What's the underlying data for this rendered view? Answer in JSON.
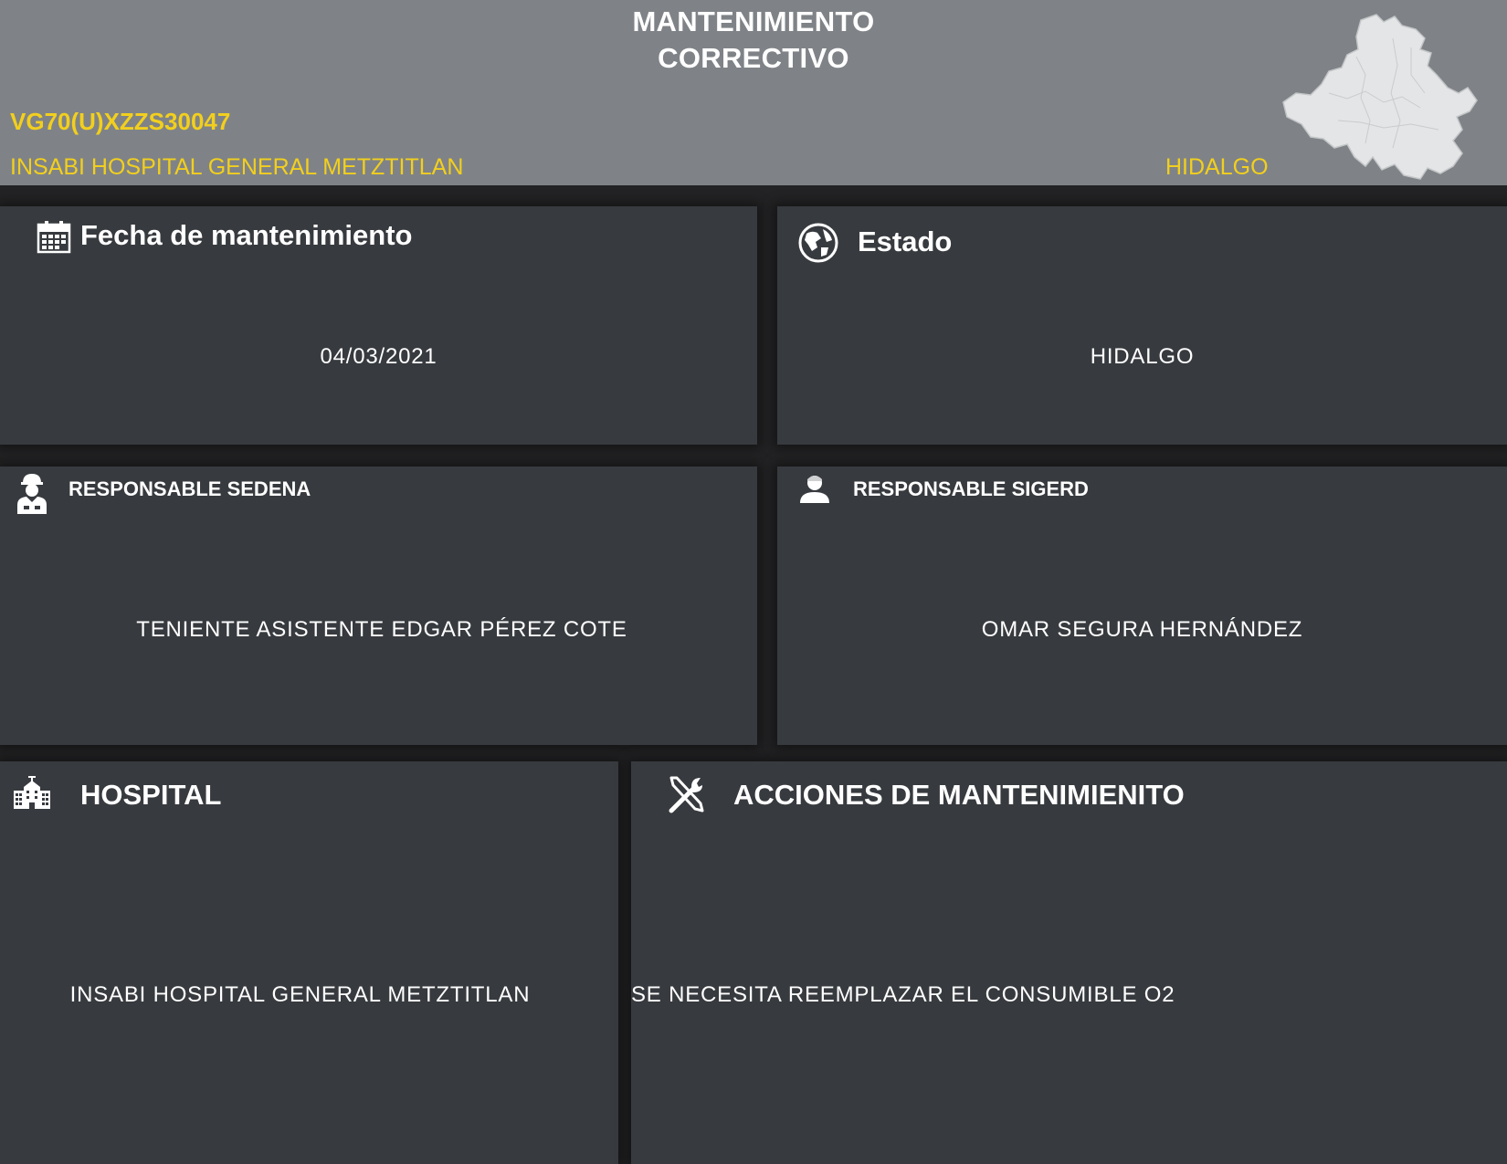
{
  "header": {
    "title_line1": "MANTENIMIENTO",
    "title_line2": "CORRECTIVO",
    "equipment_code": "VG70(U)XZZS30047",
    "hospital": "INSABI HOSPITAL GENERAL METZTITLAN",
    "state": "HIDALGO"
  },
  "cards": {
    "fecha": {
      "title": "Fecha de mantenimiento",
      "value": "04/03/2021",
      "icon": "calendar-icon"
    },
    "estado": {
      "title": "Estado",
      "value": "HIDALGO",
      "icon": "globe-icon"
    },
    "sedena": {
      "title": "RESPONSABLE SEDENA",
      "value": "TENIENTE ASISTENTE EDGAR PÉREZ COTE",
      "icon": "soldier-icon"
    },
    "sigerd": {
      "title": "RESPONSABLE SIGERD",
      "value": "OMAR SEGURA HERNÁNDEZ",
      "icon": "user-icon"
    },
    "hospital": {
      "title": "HOSPITAL",
      "value": "INSABI HOSPITAL GENERAL METZTITLAN",
      "icon": "hospital-icon"
    },
    "acciones": {
      "title": "ACCIONES DE MANTENIMIENITO",
      "value": "SE NECESITA REEMPLAZAR EL CONSUMIBLE O2",
      "icon": "tools-icon"
    }
  },
  "colors": {
    "header_bg": "#7f8387",
    "card_bg": "#373a3e",
    "accent_yellow": "#f2cf1d",
    "page_bg": "#232325"
  }
}
